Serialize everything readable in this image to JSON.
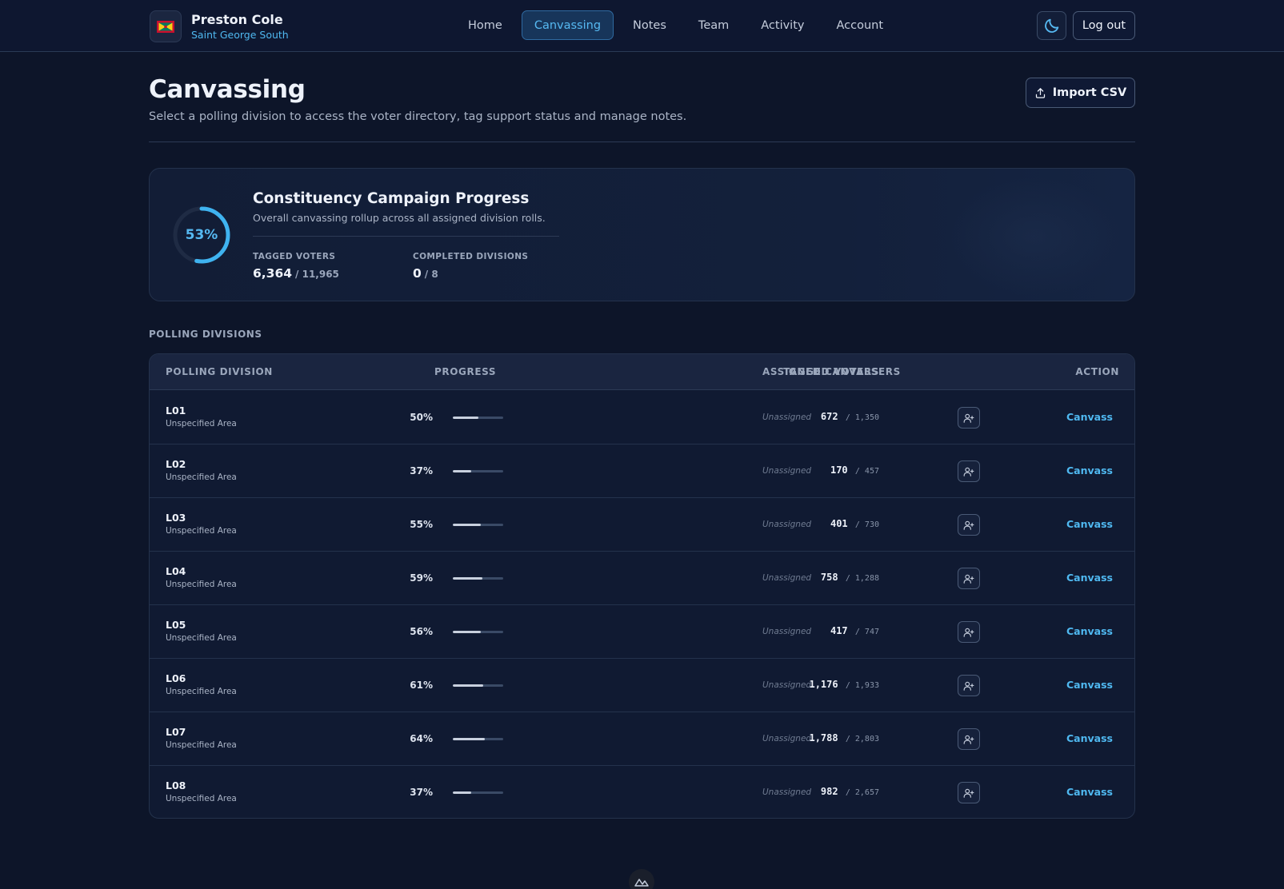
{
  "header": {
    "user_name": "Preston Cole",
    "constituency": "Saint George South",
    "nav": [
      {
        "label": "Home",
        "active": false
      },
      {
        "label": "Canvassing",
        "active": true
      },
      {
        "label": "Notes",
        "active": false
      },
      {
        "label": "Team",
        "active": false
      },
      {
        "label": "Activity",
        "active": false
      },
      {
        "label": "Account",
        "active": false
      }
    ],
    "theme_icon": "moon-icon",
    "logout_label": "Log out"
  },
  "page": {
    "title": "Canvassing",
    "subtitle": "Select a polling division to access the voter directory, tag support status and manage notes.",
    "import_label": "Import CSV"
  },
  "progress_card": {
    "percent": 53,
    "percent_label": "53%",
    "title": "Constituency Campaign Progress",
    "subtitle": "Overall canvassing rollup across all assigned division rolls.",
    "tagged_label": "TAGGED VOTERS",
    "tagged_value": "6,364",
    "tagged_total": "/ 11,965",
    "completed_label": "COMPLETED DIVISIONS",
    "completed_value": "0",
    "completed_total": "/ 8"
  },
  "section_label": "POLLING DIVISIONS",
  "table": {
    "headers": {
      "division": "POLLING DIVISION",
      "progress": "PROGRESS",
      "tagged": "TAGGED VOTERS",
      "assigned": "ASSIGNED CANVASSERS",
      "action": "ACTION"
    },
    "rows": [
      {
        "name": "L01",
        "area": "Unspecified Area",
        "pct": "50%",
        "progress": 0.5,
        "tagged": "672",
        "total": "/ 1,350",
        "assigned": "Unassigned",
        "action": "Canvass"
      },
      {
        "name": "L02",
        "area": "Unspecified Area",
        "pct": "37%",
        "progress": 0.37,
        "tagged": "170",
        "total": "/ 457",
        "assigned": "Unassigned",
        "action": "Canvass"
      },
      {
        "name": "L03",
        "area": "Unspecified Area",
        "pct": "55%",
        "progress": 0.55,
        "tagged": "401",
        "total": "/ 730",
        "assigned": "Unassigned",
        "action": "Canvass"
      },
      {
        "name": "L04",
        "area": "Unspecified Area",
        "pct": "59%",
        "progress": 0.59,
        "tagged": "758",
        "total": "/ 1,288",
        "assigned": "Unassigned",
        "action": "Canvass"
      },
      {
        "name": "L05",
        "area": "Unspecified Area",
        "pct": "56%",
        "progress": 0.56,
        "tagged": "417",
        "total": "/ 747",
        "assigned": "Unassigned",
        "action": "Canvass"
      },
      {
        "name": "L06",
        "area": "Unspecified Area",
        "pct": "61%",
        "progress": 0.61,
        "tagged": "1,176",
        "total": "/ 1,933",
        "assigned": "Unassigned",
        "action": "Canvass"
      },
      {
        "name": "L07",
        "area": "Unspecified Area",
        "pct": "64%",
        "progress": 0.64,
        "tagged": "1,788",
        "total": "/ 2,803",
        "assigned": "Unassigned",
        "action": "Canvass"
      },
      {
        "name": "L08",
        "area": "Unspecified Area",
        "pct": "37%",
        "progress": 0.37,
        "tagged": "982",
        "total": "/ 2,657",
        "assigned": "Unassigned",
        "action": "Canvass"
      }
    ]
  },
  "colors": {
    "accent": "#4fb8f0",
    "background": "#0d1529",
    "ring_track": "#1f2b44"
  }
}
